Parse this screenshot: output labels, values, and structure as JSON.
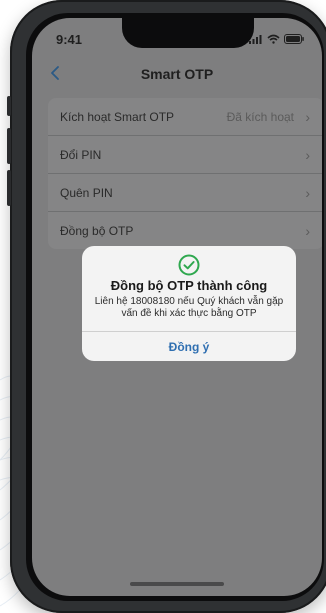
{
  "status": {
    "time": "9:41"
  },
  "nav": {
    "title": "Smart OTP"
  },
  "settings": {
    "items": [
      {
        "label": "Kích hoạt Smart OTP",
        "value": "Đã kích hoạt"
      },
      {
        "label": "Đổi PIN"
      },
      {
        "label": "Quên PIN"
      },
      {
        "label": "Đồng bộ OTP"
      }
    ]
  },
  "dialog": {
    "title": "Đồng bộ OTP thành công",
    "message": "Liên hệ 18008180 nếu Quý khách vẫn gặp vấn đề khi xác thực bằng OTP",
    "button": "Đồng ý"
  },
  "colors": {
    "accent": "#2f6fb1",
    "success": "#2fa84f"
  }
}
